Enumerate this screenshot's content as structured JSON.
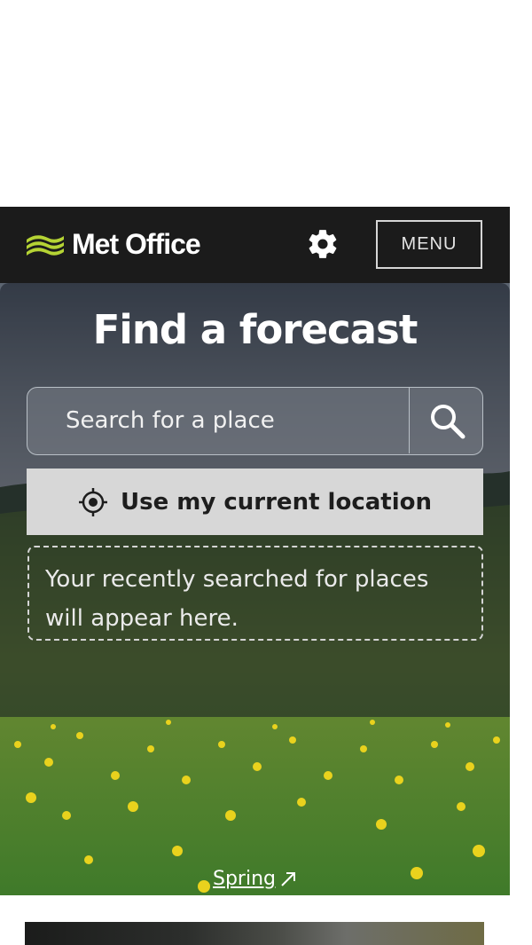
{
  "header": {
    "logo_text": "Met Office",
    "logo_icon": "met-office-waves-icon",
    "settings_icon": "gear-icon",
    "menu_label": "MENU"
  },
  "hero": {
    "title": "Find a forecast",
    "search": {
      "placeholder": "Search for a place",
      "value": "",
      "icon": "search-icon"
    },
    "location_button": {
      "label": "Use my current location",
      "icon": "crosshair-icon"
    },
    "recent_placeholder": "Your recently searched for places will appear here.",
    "image_caption": {
      "label": "Spring",
      "icon": "external-link-icon"
    }
  },
  "colors": {
    "header_bg": "#1b1b1b",
    "logo_accent": "#b5d334",
    "location_button_bg": "#d7d7d7"
  }
}
